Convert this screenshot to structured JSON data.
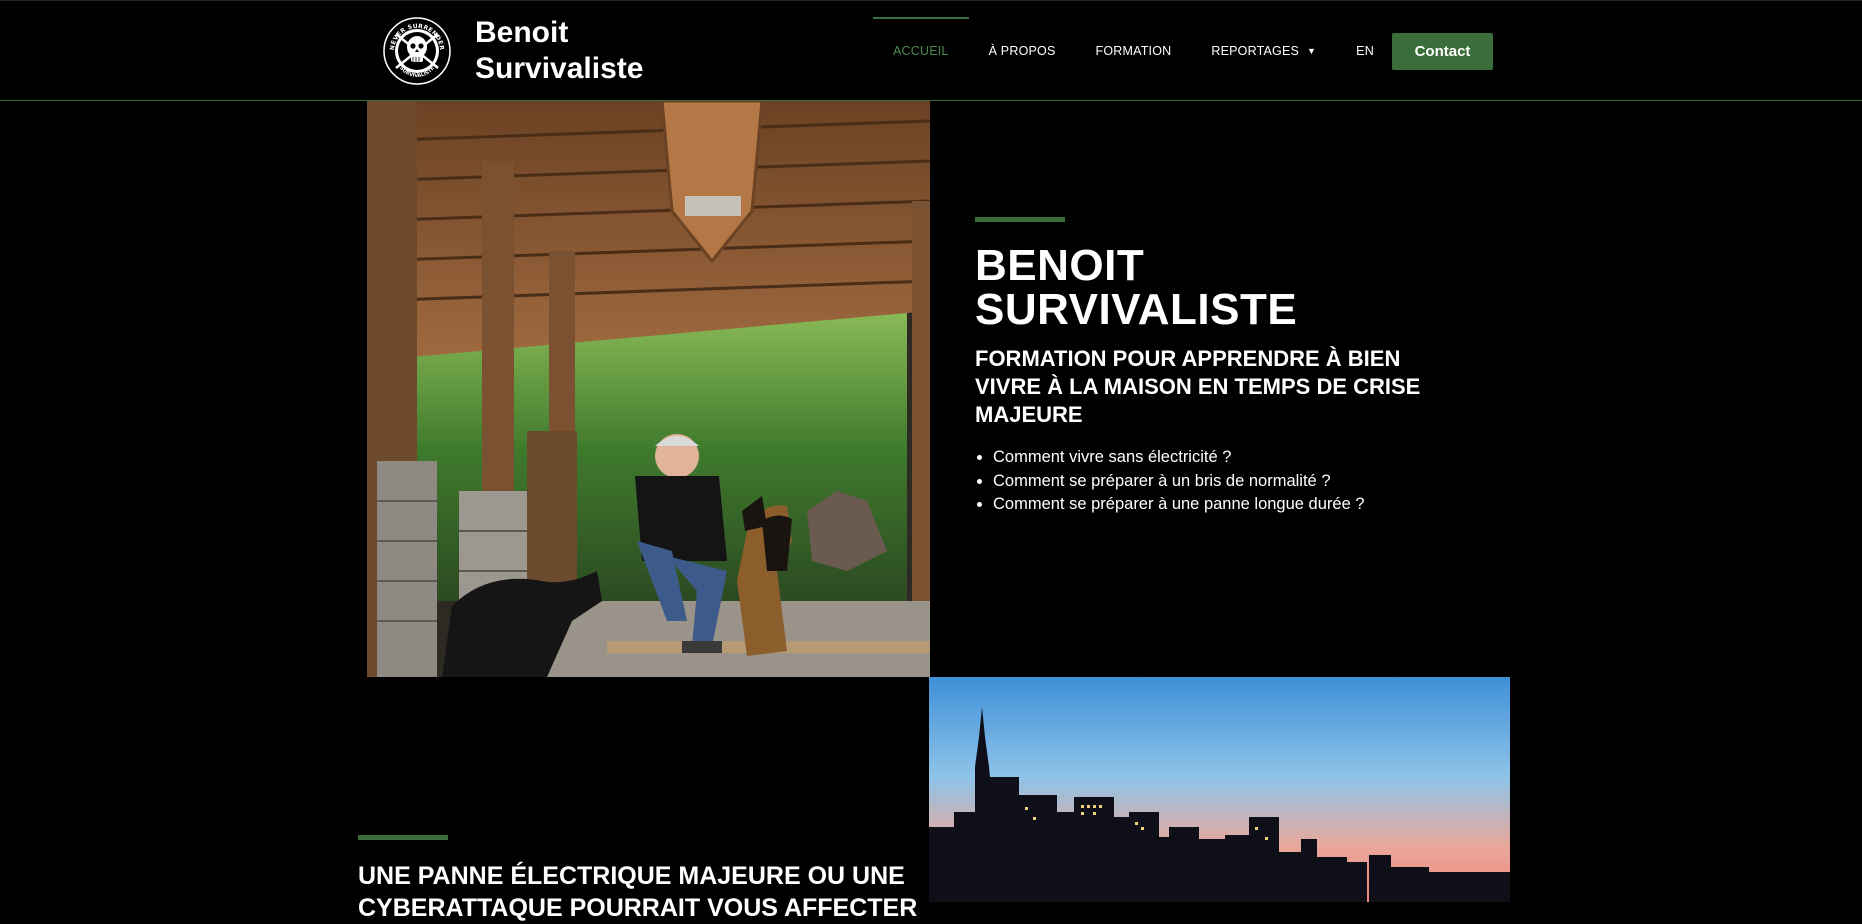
{
  "header": {
    "brand_line1": "Benoit",
    "brand_line2": "Survivaliste",
    "logo_text_top": "NEVER SURRENDER",
    "logo_text_bottom": "SURVIVALISTE"
  },
  "nav": {
    "items": [
      {
        "label": "ACCUEIL",
        "active": true
      },
      {
        "label": "À PROPOS",
        "active": false
      },
      {
        "label": "FORMATION",
        "active": false
      },
      {
        "label": "REPORTAGES",
        "active": false,
        "has_dropdown": true
      },
      {
        "label": "EN",
        "active": false
      }
    ],
    "dropdown_icon": "caret-down-icon",
    "contact_label": "Contact"
  },
  "hero": {
    "title_line1": "BENOIT",
    "title_line2": "SURVIVALISTE",
    "subtitle": "FORMATION POUR APPRENDRE À BIEN VIVRE À LA MAISON EN TEMPS DE CRISE MAJEURE",
    "bullets": [
      "Comment vivre sans électricité ?",
      "Comment se préparer à un bris de normalité ?",
      "Comment se préparer à une panne longue durée ?"
    ]
  },
  "section2": {
    "title": "UNE PANNE ÉLECTRIQUE MAJEURE OU UNE CYBERATTAQUE POURRAIT VOUS AFFECTER"
  },
  "colors": {
    "background": "#000000",
    "accent_green": "#3b6d3b",
    "active_nav": "#4e8a4e",
    "text": "#ffffff"
  }
}
